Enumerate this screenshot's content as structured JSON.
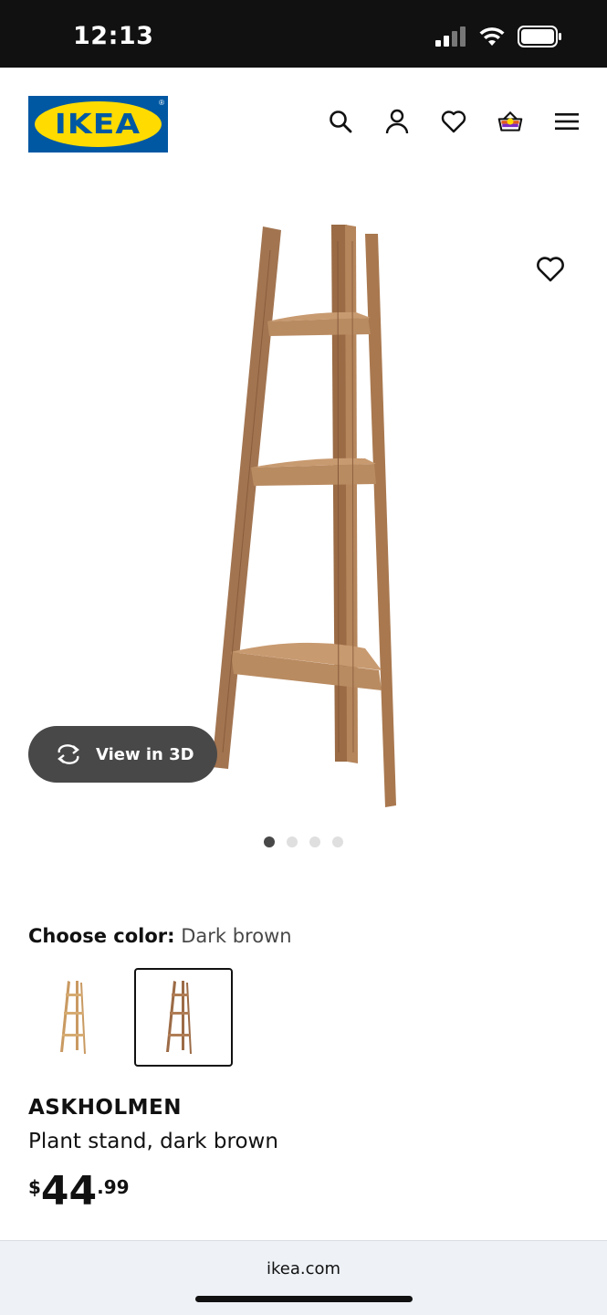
{
  "status_bar": {
    "time": "12:13"
  },
  "header": {
    "logo_text": "IKEA",
    "nav": [
      "search-icon",
      "account-icon",
      "favorites-icon",
      "cart-icon",
      "menu-icon"
    ]
  },
  "gallery": {
    "view_3d_label": "View in 3D",
    "image_count": 4,
    "active_image": 1
  },
  "color_picker": {
    "label": "Choose color:",
    "selected_value": "Dark brown",
    "options": [
      "light-wood-swatch",
      "dark-brown-swatch"
    ]
  },
  "product": {
    "name": "ASKHOLMEN",
    "description": "Plant stand, dark brown",
    "price": {
      "currency": "$",
      "integer": "44",
      "decimal": ".99"
    }
  },
  "browser": {
    "url": "ikea.com"
  },
  "colors": {
    "brand_blue": "#0058a3",
    "brand_yellow": "#ffdb00",
    "wood": "#a07550",
    "pill": "#484848"
  }
}
